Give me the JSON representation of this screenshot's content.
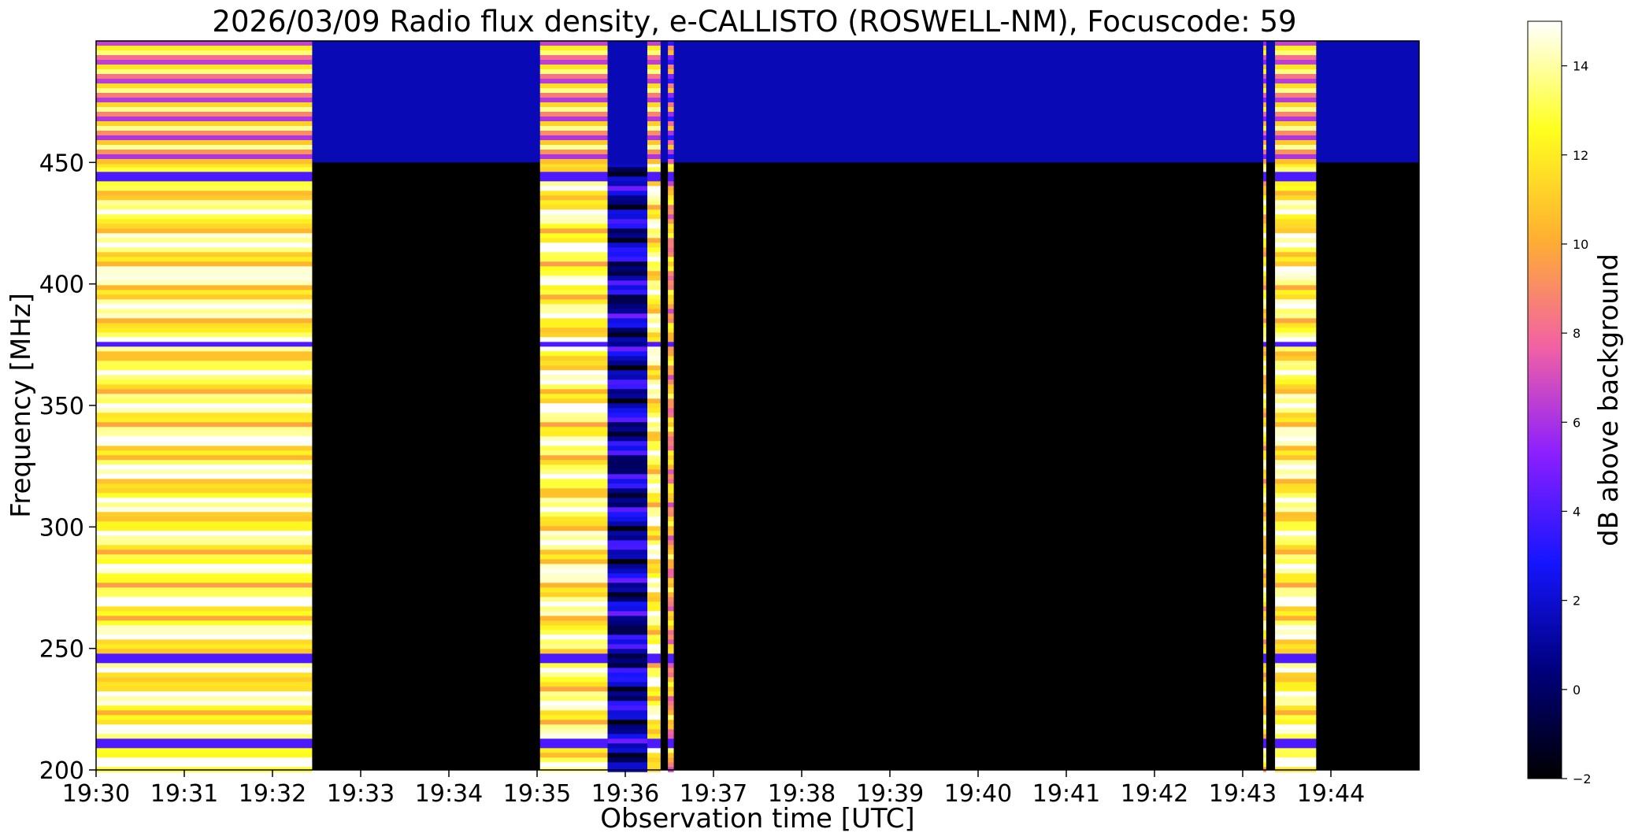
{
  "chart_data": {
    "type": "heatmap",
    "title": "2026/03/09  Radio flux density, e-CALLISTO (ROSWELL-NM), Focuscode: 59",
    "xlabel": "Observation time [UTC]",
    "ylabel": "Frequency [MHz]",
    "colorbar_label": "dB above background",
    "colormap": "gnuplot2",
    "colormap_stops": [
      "#000000",
      "#00007d",
      "#1515ff",
      "#8b1fff",
      "#f262a2",
      "#ffb030",
      "#ffff1f",
      "#ffffff"
    ],
    "x_ticks": [
      "19:30",
      "19:31",
      "19:32",
      "19:33",
      "19:34",
      "19:35",
      "19:36",
      "19:37",
      "19:38",
      "19:39",
      "19:40",
      "19:41",
      "19:42",
      "19:43",
      "19:44"
    ],
    "y_ticks": [
      200,
      250,
      300,
      350,
      400,
      450
    ],
    "xlim_minutes": [
      0,
      15
    ],
    "ylim": [
      200,
      500
    ],
    "colorbar_ticks": [
      -2,
      0,
      2,
      4,
      6,
      8,
      10,
      12,
      14
    ],
    "clim": [
      -2,
      15
    ],
    "grid": false,
    "data_segments": [
      {
        "start": "19:30:00",
        "end": "19:32:27",
        "level": 13
      },
      {
        "start": "19:35:02",
        "end": "19:35:48",
        "level": 13
      },
      {
        "start": "19:35:48",
        "end": "19:36:15",
        "level": 1.5
      },
      {
        "start": "19:36:15",
        "end": "19:36:24",
        "level": 13
      },
      {
        "start": "19:36:29",
        "end": "19:36:33",
        "level": 10
      },
      {
        "start": "19:43:14",
        "end": "19:43:16",
        "level": 12
      },
      {
        "start": "19:43:22",
        "end": "19:43:50",
        "level": 13
      }
    ],
    "background_level": -2,
    "high_band_MHz": [
      450,
      500
    ],
    "high_band_level": 1.5
  }
}
